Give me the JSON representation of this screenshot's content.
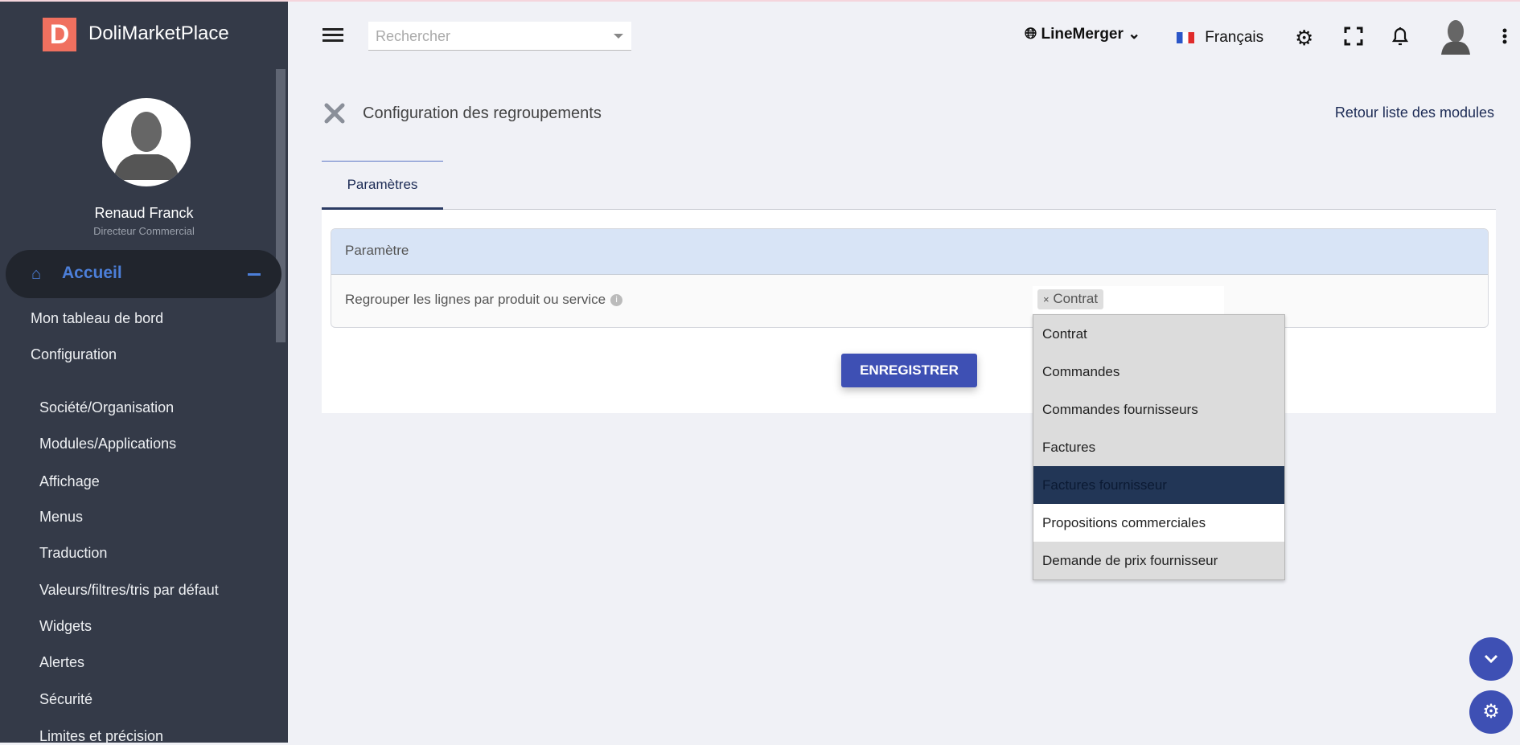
{
  "brand": {
    "logo_letter": "D",
    "name": "DoliMarketPlace"
  },
  "user": {
    "name": "Renaud Franck",
    "role": "Directeur Commercial"
  },
  "sidebar": {
    "active": "Accueil",
    "items": [
      "Mon tableau de bord",
      "Configuration"
    ],
    "subitems": [
      "Société/Organisation",
      "Modules/Applications",
      "Affichage",
      "Menus",
      "Traduction",
      "Valeurs/filtres/tris par défaut",
      "Widgets",
      "Alertes",
      "Sécurité",
      "Limites et précision"
    ]
  },
  "topbar": {
    "search_placeholder": "Rechercher",
    "module": "LineMerger",
    "language": "Français"
  },
  "page": {
    "title": "Configuration des regroupements",
    "back_link": "Retour liste des modules",
    "tab": "Paramètres"
  },
  "table": {
    "header": "Paramètre",
    "row_label": "Regrouper les lignes par produit ou service",
    "info": "i",
    "selected_tag": "Contrat",
    "tag_remove": "×"
  },
  "dropdown": {
    "options": [
      "Contrat",
      "Commandes",
      "Commandes fournisseurs",
      "Factures",
      "Factures fournisseur",
      "Propositions commerciales",
      "Demande de prix fournisseur"
    ],
    "highlighted": "Factures fournisseur"
  },
  "save_button": "ENREGISTRER",
  "colors": {
    "sidebar": "#343a48",
    "accent": "#3e50b4",
    "logo": "#f0705f"
  }
}
